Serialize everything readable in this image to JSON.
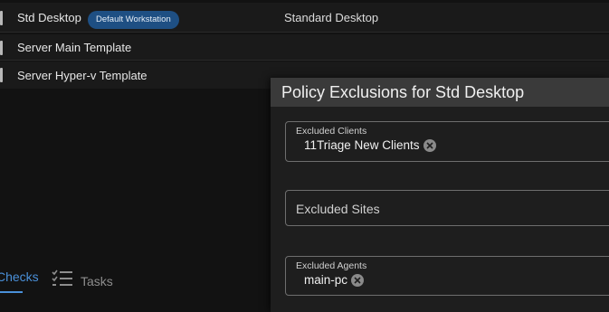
{
  "policies": [
    {
      "name": "Std Desktop",
      "badge": "Default Workstation",
      "description": "Standard Desktop"
    },
    {
      "name": "Server Main Template"
    },
    {
      "name": "Server Hyper-v Template"
    }
  ],
  "tabs": {
    "checks": "Checks",
    "tasks": "Tasks"
  },
  "dialog": {
    "title": "Policy Exclusions for Std Desktop",
    "excluded_clients": {
      "label": "Excluded Clients",
      "chips": [
        "11Triage New Clients"
      ]
    },
    "excluded_sites": {
      "placeholder": "Excluded Sites"
    },
    "excluded_agents": {
      "label": "Excluded Agents",
      "chips": [
        "main-pc"
      ]
    }
  },
  "colors": {
    "accent": "#4a90d9",
    "badge": "#1e4f83"
  }
}
